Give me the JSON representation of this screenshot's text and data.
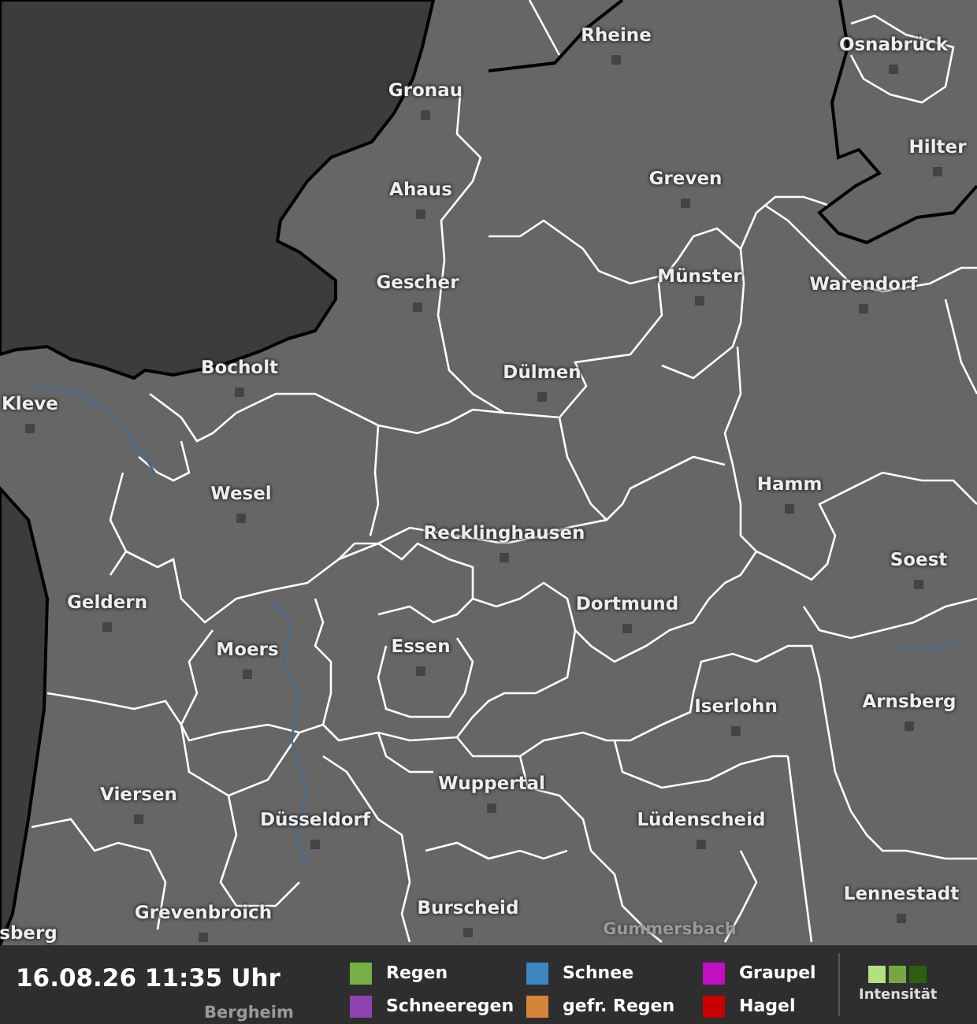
{
  "map": {
    "cities": [
      {
        "name": "Rheine"
      },
      {
        "name": "Osnabrück"
      },
      {
        "name": "Gronau"
      },
      {
        "name": "Hilter"
      },
      {
        "name": "Ahaus"
      },
      {
        "name": "Greven"
      },
      {
        "name": "Münster"
      },
      {
        "name": "Gescher"
      },
      {
        "name": "Warendorf"
      },
      {
        "name": "Bocholt"
      },
      {
        "name": "Dülmen"
      },
      {
        "name": "Kleve"
      },
      {
        "name": "Hamm"
      },
      {
        "name": "Wesel"
      },
      {
        "name": "Recklinghausen"
      },
      {
        "name": "Soest"
      },
      {
        "name": "Geldern"
      },
      {
        "name": "Dortmund"
      },
      {
        "name": "Moers"
      },
      {
        "name": "Essen"
      },
      {
        "name": "Arnsberg"
      },
      {
        "name": "Iserlohn"
      },
      {
        "name": "Viersen"
      },
      {
        "name": "Wuppertal"
      },
      {
        "name": "Düsseldorf"
      },
      {
        "name": "Lüdenscheid"
      },
      {
        "name": "Lennestadt"
      },
      {
        "name": "Grevenbroich"
      },
      {
        "name": "Burscheid"
      },
      {
        "name": "sberg"
      }
    ],
    "faded_cities": [
      {
        "name": "Gummersbach"
      },
      {
        "name": "Bergheim"
      }
    ]
  },
  "legend": {
    "timestamp": "16.08.26 11:35 Uhr",
    "items": [
      {
        "label": "Regen",
        "color": "#74b043"
      },
      {
        "label": "Schneeregen",
        "color": "#8e44b0"
      },
      {
        "label": "Schnee",
        "color": "#3d85c0"
      },
      {
        "label": "gefr. Regen",
        "color": "#d6843a"
      },
      {
        "label": "Graupel",
        "color": "#c010c0"
      },
      {
        "label": "Hagel",
        "color": "#c80000"
      }
    ],
    "intensity_label": "Intensität"
  }
}
